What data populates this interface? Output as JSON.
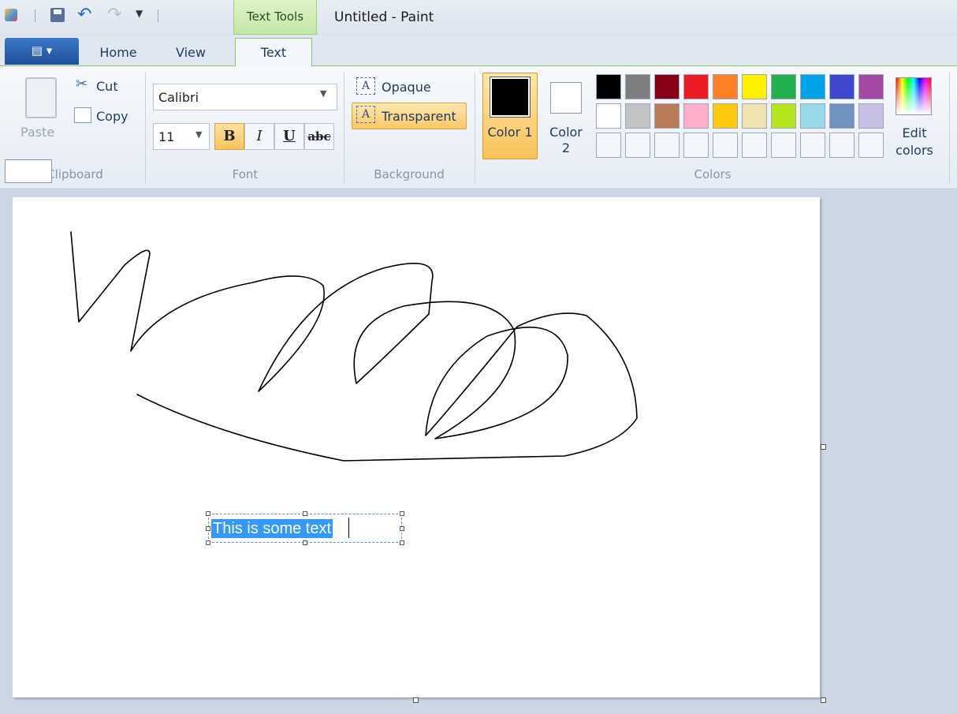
{
  "window": {
    "title": "Untitled - Paint"
  },
  "contextual_tab": "Text Tools",
  "quick_access": {
    "icons": [
      "save-icon",
      "undo-icon",
      "redo-icon",
      "dropdown-icon"
    ]
  },
  "tabs": [
    {
      "label": "Home",
      "active": false
    },
    {
      "label": "View",
      "active": false
    },
    {
      "label": "Text",
      "active": true
    }
  ],
  "ribbon": {
    "clipboard": {
      "label": "Clipboard",
      "paste": "Paste",
      "cut": "Cut",
      "copy": "Copy"
    },
    "font": {
      "label": "Font",
      "family": "Calibri",
      "size": "11",
      "bold": "B",
      "italic": "I",
      "underline": "U",
      "strikethrough": "abc",
      "bold_active": true
    },
    "background": {
      "label": "Background",
      "opaque": "Opaque",
      "transparent": "Transparent",
      "selected": "Transparent"
    },
    "colors": {
      "label": "Colors",
      "color1": "Color 1",
      "color1_value": "#000000",
      "color2": "Color 2",
      "color2_value": "#ffffff",
      "edit": "Edit colors",
      "palette_row1": [
        "#000000",
        "#7f7f7f",
        "#880015",
        "#ed1c24",
        "#ff7f27",
        "#fff200",
        "#22b14c",
        "#00a2e8",
        "#3f48cc",
        "#a349a4"
      ],
      "palette_row2": [
        "#ffffff",
        "#c3c3c3",
        "#b97a57",
        "#ffaec9",
        "#ffc90e",
        "#efe4b0",
        "#b5e61d",
        "#99d9ea",
        "#7092be",
        "#c8bfe7"
      ],
      "palette_row3": [
        "#f3f6fa",
        "#f3f6fa",
        "#f3f6fa",
        "#f3f6fa",
        "#f3f6fa",
        "#f3f6fa",
        "#f3f6fa",
        "#f3f6fa",
        "#f3f6fa",
        "#f3f6fa"
      ]
    }
  },
  "canvas": {
    "text": "This is some text",
    "selection_color": "#3399ff"
  }
}
